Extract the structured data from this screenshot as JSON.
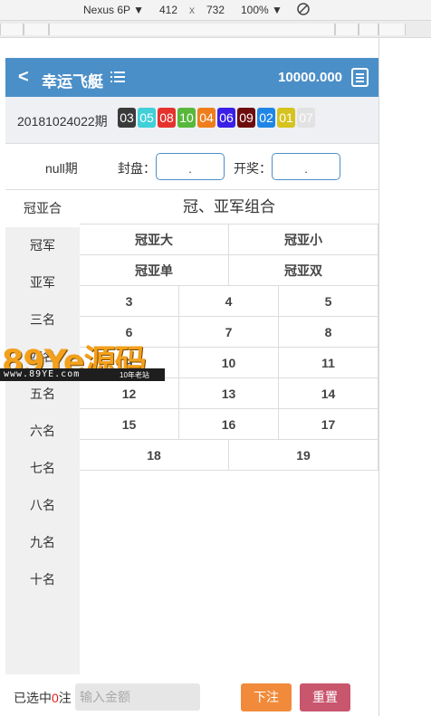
{
  "devtools": {
    "device": "Nexus 6P",
    "dropdown_arrow": "▼",
    "width": "412",
    "times": "x",
    "height": "732",
    "zoom": "100%",
    "rotate_icon": "rotate-icon"
  },
  "header": {
    "back_symbol": "<",
    "title": "幸运飞艇",
    "balance": "10000.000"
  },
  "draw": {
    "issue": "20181024022期",
    "balls": [
      {
        "num": "03",
        "color": "#3a3a3a"
      },
      {
        "num": "05",
        "color": "#3fd0d8"
      },
      {
        "num": "08",
        "color": "#e6322d"
      },
      {
        "num": "10",
        "color": "#58b83c"
      },
      {
        "num": "04",
        "color": "#f07d1c"
      },
      {
        "num": "06",
        "color": "#3a1fe6"
      },
      {
        "num": "09",
        "color": "#6e0d0d"
      },
      {
        "num": "02",
        "color": "#1f86e6"
      },
      {
        "num": "01",
        "color": "#d6c31f"
      },
      {
        "num": "07",
        "color": "#e2e2e2"
      }
    ]
  },
  "period": {
    "label": "null期",
    "seal_label": "封盘：",
    "seal_value": ".",
    "open_label": "开奖：",
    "open_value": "."
  },
  "sidebar": {
    "items": [
      "冠亚合",
      "冠军",
      "亚军",
      "三名",
      "四名",
      "五名",
      "六名",
      "七名",
      "八名",
      "九名",
      "十名"
    ],
    "active_index": 0
  },
  "content": {
    "title": "冠、亚军组合",
    "options_row1": [
      "冠亚大",
      "冠亚小"
    ],
    "options_row2": [
      "冠亚单",
      "冠亚双"
    ],
    "numbers": [
      "3",
      "4",
      "5",
      "6",
      "7",
      "8",
      "9",
      "10",
      "11",
      "12",
      "13",
      "14",
      "15",
      "16",
      "17",
      "18",
      "19"
    ]
  },
  "footer": {
    "selected_prefix": "已选中",
    "selected_count": "0",
    "selected_suffix": "注",
    "amount_placeholder": "输入金额",
    "bet_label": "下注",
    "reset_label": "重置"
  },
  "watermark": {
    "brand": "89Ye源码",
    "url": "www.89YE.com",
    "tagline": "10年老站"
  }
}
